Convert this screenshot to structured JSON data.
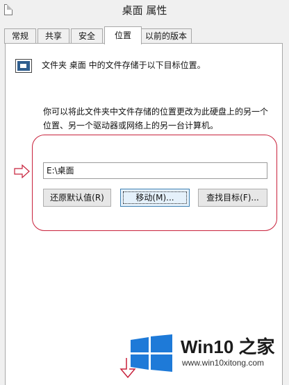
{
  "window": {
    "title": "桌面 属性"
  },
  "tabs": [
    {
      "label": "常规",
      "active": false
    },
    {
      "label": "共享",
      "active": false
    },
    {
      "label": "安全",
      "active": false
    },
    {
      "label": "位置",
      "active": true
    },
    {
      "label": "以前的版本",
      "active": false
    }
  ],
  "location": {
    "header": "文件夹 桌面 中的文件存储于以下目标位置。",
    "description_line1": "你可以将此文件夹中文件存储的位置更改为此硬盘上的另一个",
    "description_line2": "位置、另一个驱动器或网络上的另一台计算机。",
    "path_value": "E:\\桌面",
    "buttons": {
      "restore_default": "还原默认值(R)",
      "move": "移动(M)...",
      "find_target": "查找目标(F)..."
    }
  },
  "watermark": {
    "brand": "Win10 之家",
    "url": "www.win10xitong.com"
  },
  "colors": {
    "highlight": "#c8203a",
    "logo_blue": "#1e7ad8"
  },
  "icons": [
    "document-icon",
    "folder-location-icon",
    "arrow-right-icon",
    "windows-logo-icon"
  ]
}
